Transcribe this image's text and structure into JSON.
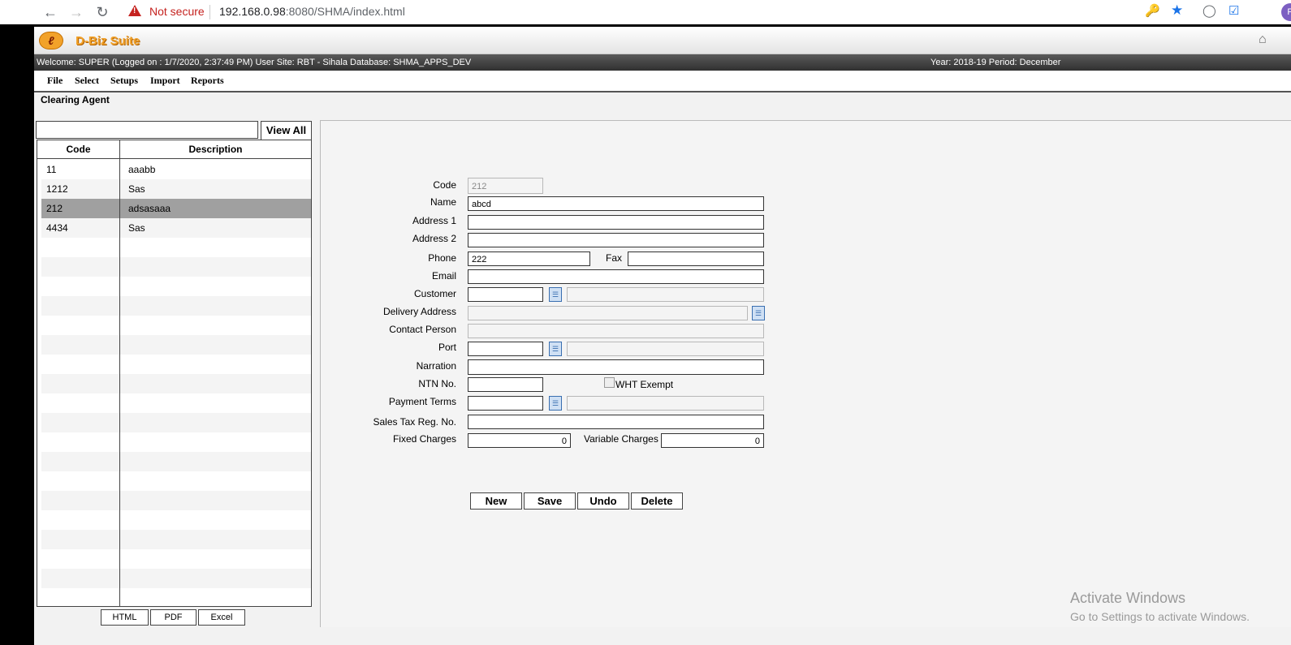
{
  "browser": {
    "not_secure": "Not secure",
    "url_host": "192.168.0.98",
    "url_rest": ":8080/SHMA/index.html",
    "profile_initial": "P"
  },
  "app": {
    "logo_text": "D-Biz Suite",
    "welcome": "Welcome: SUPER (Logged on : 1/7/2020, 2:37:49 PM) User Site: RBT - Sihala Database: SHMA_APPS_DEV",
    "year_period": "Year: 2018-19 Period: December",
    "menu": [
      "File",
      "Select",
      "Setups",
      "Import",
      "Reports"
    ],
    "page_title": "Clearing Agent"
  },
  "list": {
    "view_all": "View All",
    "headers": {
      "code": "Code",
      "description": "Description"
    },
    "rows": [
      {
        "code": "11",
        "description": "aaabb"
      },
      {
        "code": "1212",
        "description": "Sas"
      },
      {
        "code": "212",
        "description": "adsasaaa"
      },
      {
        "code": "4434",
        "description": "Sas"
      }
    ],
    "export": {
      "html": "HTML",
      "pdf": "PDF",
      "excel": "Excel"
    }
  },
  "form": {
    "labels": {
      "code": "Code",
      "name": "Name",
      "address1": "Address 1",
      "address2": "Address 2",
      "phone": "Phone",
      "fax": "Fax",
      "email": "Email",
      "customer": "Customer",
      "delivery_address": "Delivery Address",
      "contact_person": "Contact Person",
      "port": "Port",
      "narration": "Narration",
      "ntn": "NTN No.",
      "wht": "WHT Exempt",
      "payment_terms": "Payment Terms",
      "sales_tax": "Sales Tax Reg. No.",
      "fixed_charges": "Fixed Charges",
      "variable_charges": "Variable Charges"
    },
    "values": {
      "code": "212",
      "name": "abcd",
      "phone": "222",
      "fixed_charges": "0",
      "variable_charges": "0"
    },
    "buttons": {
      "new": "New",
      "save": "Save",
      "undo": "Undo",
      "delete": "Delete"
    }
  },
  "watermark": {
    "title": "Activate Windows",
    "subtitle": "Go to Settings to activate Windows."
  }
}
